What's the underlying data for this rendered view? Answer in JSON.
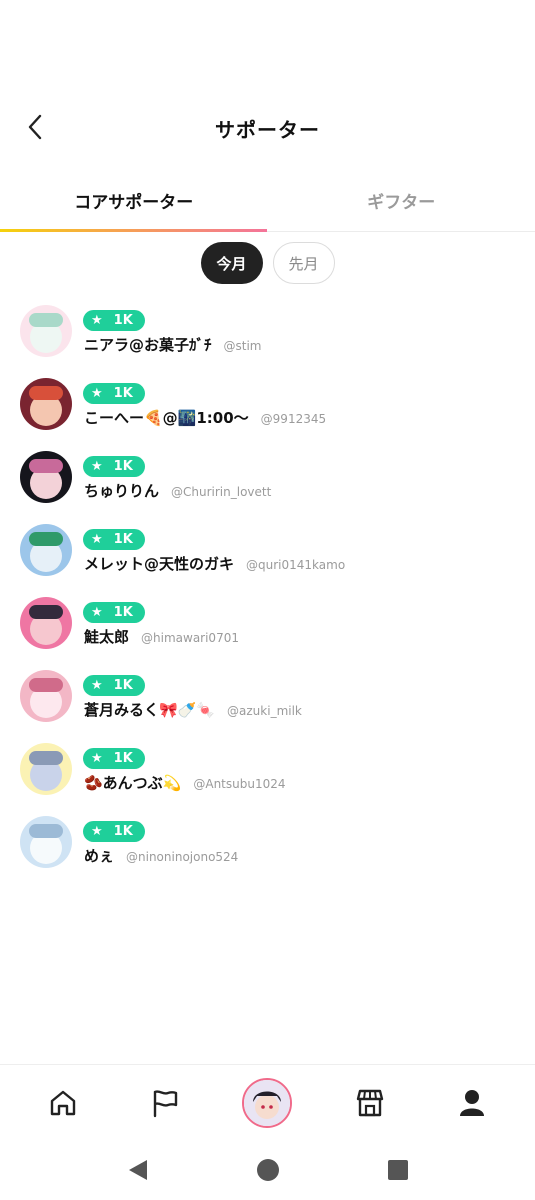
{
  "header": {
    "title": "サポーター"
  },
  "tabs": [
    {
      "label": "コアサポーター",
      "active": true
    },
    {
      "label": "ギフター",
      "active": false
    }
  ],
  "periods": [
    {
      "label": "今月",
      "active": true
    },
    {
      "label": "先月",
      "active": false
    }
  ],
  "supporters": [
    {
      "badge": "1K",
      "name": "ニアラ@お菓子ｶﾞﾁ",
      "handle": "@stim",
      "avatar_colors": [
        "#fbe4ec",
        "#eef7f3",
        "#a9d9c9"
      ]
    },
    {
      "badge": "1K",
      "name": "こーへー🍕@🌃1:00〜",
      "handle": "@9912345",
      "avatar_colors": [
        "#7a2430",
        "#f4c6b0",
        "#d8503a"
      ]
    },
    {
      "badge": "1K",
      "name": "ちゅりりん",
      "handle": "@Churirin_lovett",
      "avatar_colors": [
        "#15151c",
        "#f3d2d8",
        "#c86a9a"
      ]
    },
    {
      "badge": "1K",
      "name": "メレット@天性のガキ",
      "handle": "@quri0141kamo",
      "avatar_colors": [
        "#9cc6ea",
        "#e6f0f8",
        "#2f9a6a"
      ]
    },
    {
      "badge": "1K",
      "name": "鮭太郎",
      "handle": "@himawari0701",
      "avatar_colors": [
        "#ef76a3",
        "#f6c7cf",
        "#332a3c"
      ]
    },
    {
      "badge": "1K",
      "name": "蒼月みるく🎀🍼🍬",
      "handle": "@azuki_milk",
      "avatar_colors": [
        "#f3b7c6",
        "#fde8ee",
        "#d06b8a"
      ]
    },
    {
      "badge": "1K",
      "name": "🫘あんつぶ💫",
      "handle": "@Antsubu1024",
      "avatar_colors": [
        "#fbf2b4",
        "#c9d3ea",
        "#8a9ab6"
      ]
    },
    {
      "badge": "1K",
      "name": "めぇ",
      "handle": "@ninoninojono524",
      "avatar_colors": [
        "#cfe3f4",
        "#f6fafc",
        "#9cbad6"
      ]
    }
  ],
  "bottom_nav": [
    {
      "name": "home-icon"
    },
    {
      "name": "flag-icon"
    },
    {
      "name": "profile-avatar"
    },
    {
      "name": "store-icon"
    },
    {
      "name": "user-icon"
    }
  ],
  "system_nav": [
    {
      "name": "back-triangle-icon"
    },
    {
      "name": "home-circle-icon"
    },
    {
      "name": "recents-square-icon"
    }
  ],
  "colors": {
    "badge": "#1fcf9a",
    "tab_underline": [
      "#f5d20b",
      "#f6a64b",
      "#f4749a"
    ],
    "active_pill": "#222222"
  }
}
